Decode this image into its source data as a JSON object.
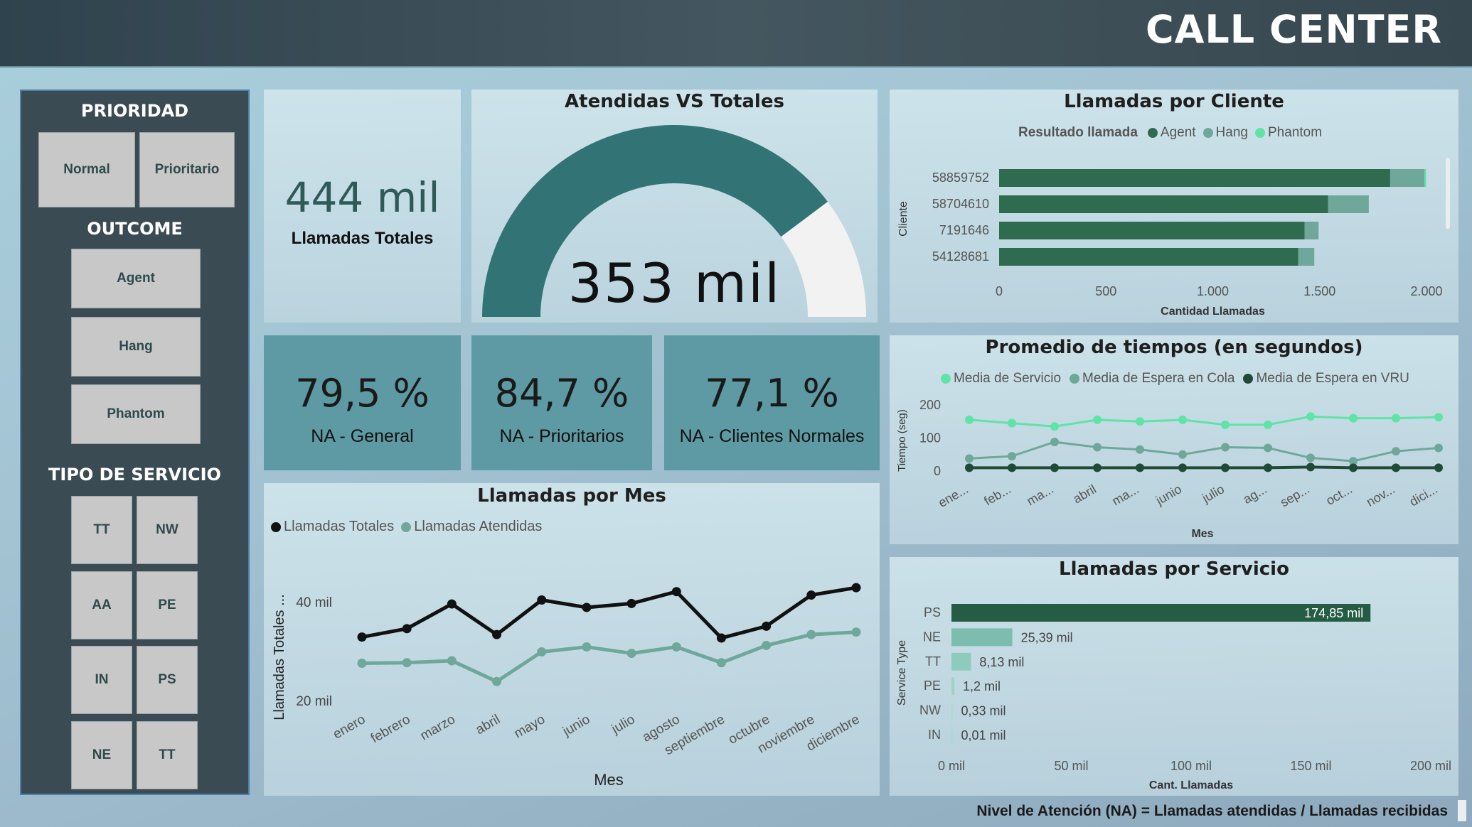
{
  "header": {
    "title": "CALL CENTER"
  },
  "sidebar": {
    "prioridad_heading": "PRIORIDAD",
    "prioridad_items": [
      "Normal",
      "Prioritario"
    ],
    "outcome_heading": "OUTCOME",
    "outcome_items": [
      "Agent",
      "Hang",
      "Phantom"
    ],
    "tipo_heading": "TIPO DE SERVICIO",
    "tipo_items": [
      "TT",
      "NW",
      "AA",
      "PE",
      "IN",
      "PS",
      "NE",
      "TT"
    ]
  },
  "kpi_total": {
    "value": "444 mil",
    "label": "Llamadas Totales"
  },
  "gauge": {
    "title": "Atendidas VS Totales",
    "value_label": "353 mil",
    "fraction": 0.795,
    "fill_color": "#327475",
    "rest_color": "#f2f2f2"
  },
  "na_cards": [
    {
      "value": "79,5 %",
      "label": "NA - General"
    },
    {
      "value": "84,7 %",
      "label": "NA - Prioritarios"
    },
    {
      "value": "77,1 %",
      "label": "NA - Clientes Normales"
    }
  ],
  "colors": {
    "dark_green": "#2e6b4f",
    "mid_green": "#6fa89b",
    "light_green": "#5fe3a6",
    "teal_card": "#5e9aa3"
  },
  "footer": {
    "note": "Nivel de Atención (NA) = Llamadas atendidas / Llamadas recibidas"
  },
  "chart_data": [
    {
      "id": "clientes",
      "type": "bar",
      "orientation": "horizontal",
      "stacked": true,
      "title": "Llamadas por Cliente",
      "legend_title": "Resultado llamada",
      "xlabel": "Cantidad Llamadas",
      "ylabel": "Cliente",
      "categories": [
        "58859752",
        "58704610",
        "7191646",
        "54128681"
      ],
      "series": [
        {
          "name": "Agent",
          "color": "#2e6b4f",
          "values": [
            1830,
            1540,
            1430,
            1400
          ]
        },
        {
          "name": "Hang",
          "color": "#6fa89b",
          "values": [
            160,
            190,
            65,
            75
          ]
        },
        {
          "name": "Phantom",
          "color": "#5fe3a6",
          "values": [
            8,
            0,
            0,
            0
          ]
        }
      ],
      "xlim": [
        0,
        2000
      ],
      "xticks": [
        0,
        500,
        1000,
        1500,
        2000
      ],
      "xtick_labels": [
        "0",
        "500",
        "1.000",
        "1.500",
        "2.000"
      ],
      "legend_position": "top"
    },
    {
      "id": "tiempos",
      "type": "line",
      "title": "Promedio de tiempos (en segundos)",
      "xlabel": "Mes",
      "ylabel": "Tiempo (seg)",
      "categories": [
        "ene...",
        "feb...",
        "ma...",
        "abril",
        "ma...",
        "junio",
        "julio",
        "ag...",
        "sep...",
        "oct...",
        "nov...",
        "dici..."
      ],
      "series": [
        {
          "name": "Media de Servicio",
          "color": "#5fe3a6",
          "values": [
            155,
            145,
            135,
            155,
            150,
            155,
            140,
            140,
            165,
            160,
            160,
            163
          ]
        },
        {
          "name": "Media de Espera en Cola",
          "color": "#6fa89b",
          "values": [
            38,
            45,
            88,
            72,
            65,
            50,
            72,
            70,
            40,
            30,
            60,
            70
          ]
        },
        {
          "name": "Media de Espera en VRU",
          "color": "#1f4a36",
          "values": [
            10,
            10,
            10,
            10,
            10,
            10,
            10,
            10,
            12,
            10,
            10,
            10
          ]
        }
      ],
      "ylim": [
        0,
        200
      ],
      "yticks": [
        0,
        100,
        200
      ],
      "legend_position": "top"
    },
    {
      "id": "mes",
      "type": "line",
      "title": "Llamadas por Mes",
      "xlabel": "Mes",
      "ylabel": "Llamadas Totales ...",
      "categories": [
        "enero",
        "febrero",
        "marzo",
        "abril",
        "mayo",
        "junio",
        "julio",
        "agosto",
        "septiembre",
        "octubre",
        "noviembre",
        "diciembre"
      ],
      "series": [
        {
          "name": "Llamadas Totales",
          "color": "#111111",
          "values": [
            33000,
            34700,
            39700,
            33500,
            40500,
            39000,
            39800,
            42200,
            32800,
            35200,
            41500,
            43000
          ]
        },
        {
          "name": "Llamadas Atendidas",
          "color": "#6fa89b",
          "values": [
            27700,
            27800,
            28200,
            24000,
            30000,
            31000,
            29700,
            31000,
            27800,
            31300,
            33500,
            34000
          ]
        }
      ],
      "ylim": [
        16000,
        46000
      ],
      "yticks": [
        20000,
        40000
      ],
      "ytick_labels": [
        "20 mil",
        "40 mil"
      ],
      "legend_position": "top-left"
    },
    {
      "id": "servicio",
      "type": "bar",
      "orientation": "horizontal",
      "title": "Llamadas por Servicio",
      "xlabel": "Cant. Llamadas",
      "ylabel": "Service Type",
      "categories": [
        "PS",
        "NE",
        "TT",
        "PE",
        "NW",
        "IN"
      ],
      "values": [
        174850,
        25390,
        8130,
        1200,
        330,
        10
      ],
      "data_labels": [
        "174,85 mil",
        "25,39 mil",
        "8,13 mil",
        "1,2 mil",
        "0,33 mil",
        "0,01 mil"
      ],
      "colors": [
        "#245c45",
        "#7cbdb0",
        "#8dcbbd",
        "#9dd4c7",
        "#a8dacd",
        "#a8dacd"
      ],
      "xlim": [
        0,
        200000
      ],
      "xticks": [
        0,
        50000,
        100000,
        150000,
        200000
      ],
      "xtick_labels": [
        "0 mil",
        "50 mil",
        "100 mil",
        "150 mil",
        "200 mil"
      ]
    }
  ]
}
